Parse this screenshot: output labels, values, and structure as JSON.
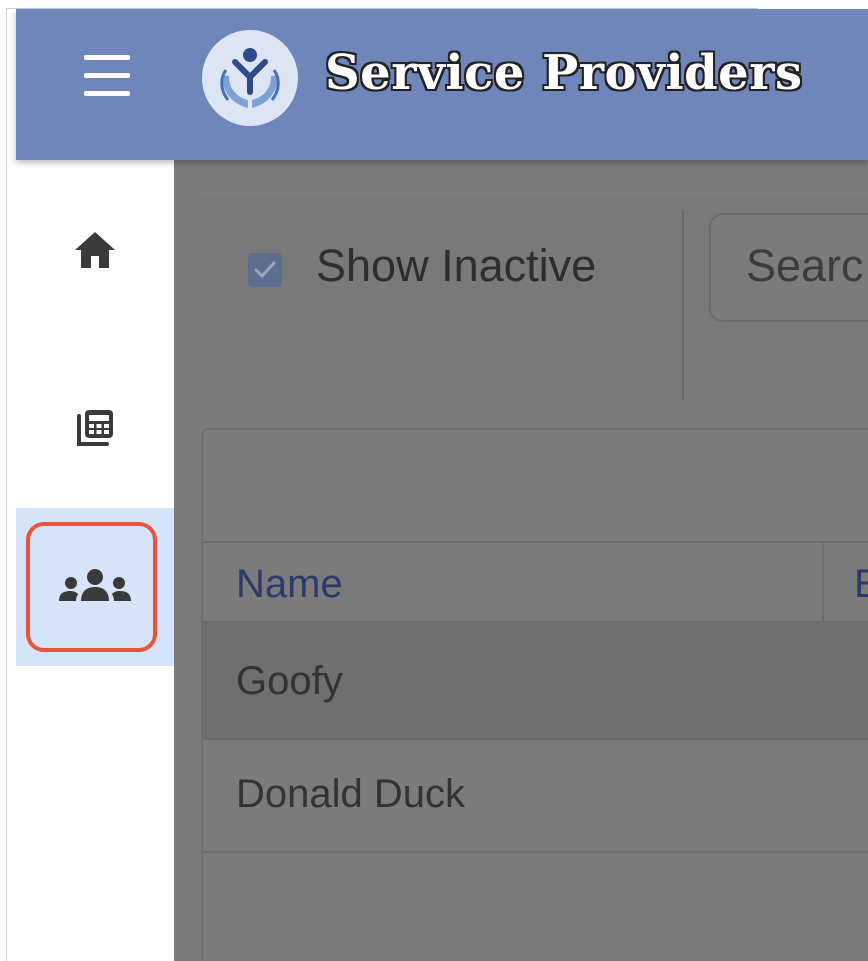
{
  "app": {
    "title": "Service Providers",
    "logo_icon": "hands-person-icon",
    "menu_icon": "hamburger-menu-icon",
    "header_color": "#6e86ba"
  },
  "sidebar": {
    "items": [
      {
        "name": "home",
        "icon": "home-icon",
        "active": false
      },
      {
        "name": "calculator",
        "icon": "calculator-icon",
        "active": false
      },
      {
        "name": "people",
        "icon": "users-group-icon",
        "active": true
      }
    ],
    "highlight_color": "#e8553a",
    "active_bg": "#d6e4fb"
  },
  "toolbar": {
    "show_inactive_label": "Show Inactive",
    "show_inactive_checked": true,
    "search_placeholder": "Searc"
  },
  "table": {
    "columns": [
      "Name",
      "E"
    ],
    "rows": [
      {
        "name": "Goofy"
      },
      {
        "name": "Donald Duck"
      }
    ]
  }
}
